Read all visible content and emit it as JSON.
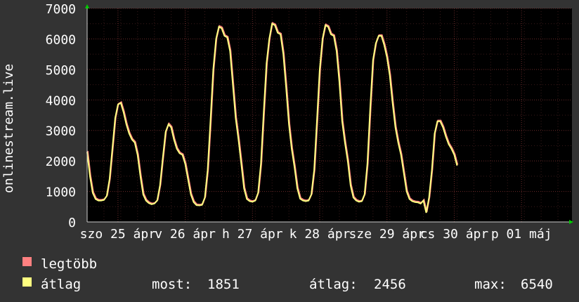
{
  "chart_data": {
    "type": "line",
    "ylabel": "onlinestream.live",
    "ylim": [
      0,
      7000
    ],
    "yticks": [
      0,
      1000,
      2000,
      3000,
      4000,
      5000,
      6000,
      7000
    ],
    "grid": true,
    "xtick_labels": [
      "szo 25 ápr",
      "v 26 ápr",
      "h 27 ápr",
      "k 28 ápr",
      "sze 29 ápr",
      "cs 30 ápr",
      "p 01 máj"
    ],
    "series": [
      {
        "name": "legtöbb",
        "color": "#ff8080"
      },
      {
        "name": "átlag",
        "color": "#ffff80"
      }
    ],
    "x_unit": "hours since first tick label",
    "x": [
      -11,
      -10,
      -9,
      -8,
      -7,
      -6,
      -5,
      -4,
      -3,
      -2,
      -1,
      0,
      1,
      2,
      3,
      4,
      5,
      6,
      7,
      8,
      9,
      10,
      11,
      12,
      13,
      14,
      15,
      16,
      17,
      18,
      19,
      20,
      21,
      22,
      23,
      24,
      25,
      26,
      27,
      28,
      29,
      30,
      31,
      32,
      33,
      34,
      35,
      36,
      37,
      38,
      39,
      40,
      41,
      42,
      43,
      44,
      45,
      46,
      47,
      48,
      49,
      50,
      51,
      52,
      53,
      54,
      55,
      56,
      57,
      58,
      59,
      60,
      61,
      62,
      63,
      64,
      65,
      66,
      67,
      68,
      69,
      70,
      71,
      72,
      73,
      74,
      75,
      76,
      77,
      78,
      79,
      80,
      81,
      82,
      83,
      84,
      85,
      86,
      87,
      88,
      89,
      90,
      91,
      92,
      93,
      94,
      95,
      96,
      97,
      98,
      99,
      100,
      101,
      102,
      103,
      104,
      105,
      106,
      107,
      108,
      109,
      110,
      111,
      112,
      113,
      114,
      115,
      116,
      117,
      118,
      119,
      120,
      121,
      122,
      123,
      124,
      125,
      126,
      127,
      128,
      129,
      130,
      131,
      132,
      133,
      134,
      135,
      136,
      137,
      138,
      139,
      140,
      141,
      142,
      143,
      144,
      145,
      146,
      147,
      148,
      149,
      150,
      151,
      152,
      153,
      154,
      155,
      156,
      157,
      158,
      159,
      160
    ],
    "values": [
      2300,
      1500,
      950,
      750,
      700,
      700,
      720,
      850,
      1400,
      2400,
      3400,
      3850,
      3900,
      3600,
      3200,
      2900,
      2700,
      2600,
      2200,
      1500,
      900,
      700,
      620,
      580,
      600,
      700,
      1200,
      2100,
      2950,
      3200,
      3100,
      2700,
      2400,
      2250,
      2200,
      1900,
      1400,
      900,
      650,
      550,
      540,
      560,
      800,
      1700,
      3300,
      5000,
      6000,
      6400,
      6350,
      6100,
      6050,
      5600,
      4500,
      3400,
      2700,
      1900,
      1100,
      750,
      680,
      660,
      700,
      950,
      1900,
      3600,
      5200,
      6000,
      6500,
      6450,
      6200,
      6150,
      5500,
      4400,
      3200,
      2400,
      1800,
      1100,
      760,
      700,
      680,
      700,
      900,
      1700,
      3300,
      5000,
      6000,
      6450,
      6400,
      6150,
      6100,
      5600,
      4600,
      3300,
      2600,
      2000,
      1200,
      800,
      700,
      660,
      680,
      900,
      1900,
      3700,
      5300,
      5850,
      6100,
      6100,
      5800,
      5400,
      4800,
      3900,
      3100,
      2600,
      2200,
      1600,
      1000,
      750,
      680,
      650,
      640,
      600,
      700,
      300,
      800,
      1700,
      2900,
      3300,
      3300,
      3100,
      2800,
      2550,
      2400,
      2200,
      1850
    ],
    "stats": {
      "label_now": "most:",
      "now": 1851,
      "label_avg": "átlag:",
      "avg": 2456,
      "label_max": "max:",
      "max": 6540
    }
  }
}
